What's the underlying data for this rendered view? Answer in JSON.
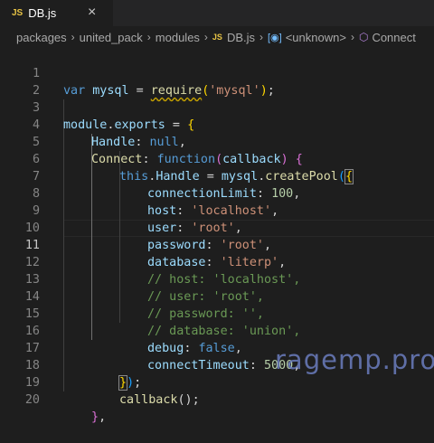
{
  "tab": {
    "badge": "JS",
    "filename": "DB.js",
    "close_glyph": "×"
  },
  "breadcrumb": {
    "items": [
      "packages",
      "united_pack",
      "modules",
      "DB.js",
      "<unknown>",
      "Connect"
    ],
    "separator": "›",
    "badge": "JS"
  },
  "editor": {
    "current_line": 11,
    "lines": [
      {
        "n": "1"
      },
      {
        "n": "2"
      },
      {
        "n": "3"
      },
      {
        "n": "4"
      },
      {
        "n": "5"
      },
      {
        "n": "6"
      },
      {
        "n": "7"
      },
      {
        "n": "8"
      },
      {
        "n": "9"
      },
      {
        "n": "10"
      },
      {
        "n": "11"
      },
      {
        "n": "12"
      },
      {
        "n": "13"
      },
      {
        "n": "14"
      },
      {
        "n": "15"
      },
      {
        "n": "16"
      },
      {
        "n": "17"
      },
      {
        "n": "18"
      },
      {
        "n": "19"
      },
      {
        "n": "20"
      }
    ]
  },
  "code": {
    "l1": {
      "kw": "var",
      "name": "mysql",
      "eq": " = ",
      "fn": "require",
      "open": "(",
      "str": "'mysql'",
      "close": ")",
      "semi": ";"
    },
    "l3": {
      "obj": "module",
      "dot": ".",
      "prop": "exports",
      "rest": " = ",
      "brace": "{"
    },
    "l4": {
      "prop": "Handle",
      "colon": ": ",
      "val": "null",
      "comma": ","
    },
    "l5": {
      "prop": "Connect",
      "colon": ": ",
      "kw": "function",
      "open": "(",
      "param": "callback",
      "close": ")",
      "brace": " {"
    },
    "l6": {
      "kw": "this",
      "dot": ".",
      "prop": "Handle",
      "eq": " = ",
      "obj": "mysql",
      "dot2": ".",
      "fn": "createPool",
      "open": "(",
      "brace": "{"
    },
    "l7": {
      "prop": "connectionLimit",
      "colon": ": ",
      "num": "100",
      "comma": ","
    },
    "l8": {
      "prop": "host",
      "colon": ": ",
      "str": "'localhost'",
      "comma": ","
    },
    "l9": {
      "prop": "user",
      "colon": ": ",
      "str": "'root'",
      "comma": ","
    },
    "l10": {
      "prop": "password",
      "colon": ": ",
      "str": "'root'",
      "comma": ","
    },
    "l11": {
      "prop": "database",
      "colon": ": ",
      "str": "'literp'",
      "comma": ","
    },
    "l12": {
      "comment": "// host: 'localhost',"
    },
    "l13": {
      "comment": "// user: 'root',"
    },
    "l14": {
      "comment": "// password: '',"
    },
    "l15": {
      "comment": "// database: 'union',"
    },
    "l16": {
      "prop": "debug",
      "colon": ": ",
      "kw": "false",
      "comma": ","
    },
    "l17": {
      "prop": "connectTimeout",
      "colon": ": ",
      "num": "5000",
      "comma": ","
    },
    "l18": {
      "brace": "}",
      "close": ")",
      "semi": ";"
    },
    "l19": {
      "fn": "callback",
      "call": "();"
    },
    "l20": {
      "brace": "}",
      "comma": ","
    }
  },
  "watermark": {
    "text": "ragemp.pro"
  },
  "colors": {
    "keyword": "#569cd6",
    "variable": "#9cdcfe",
    "function": "#dcdcaa",
    "string": "#ce9178",
    "number": "#b5cea8",
    "comment": "#6a9955"
  }
}
